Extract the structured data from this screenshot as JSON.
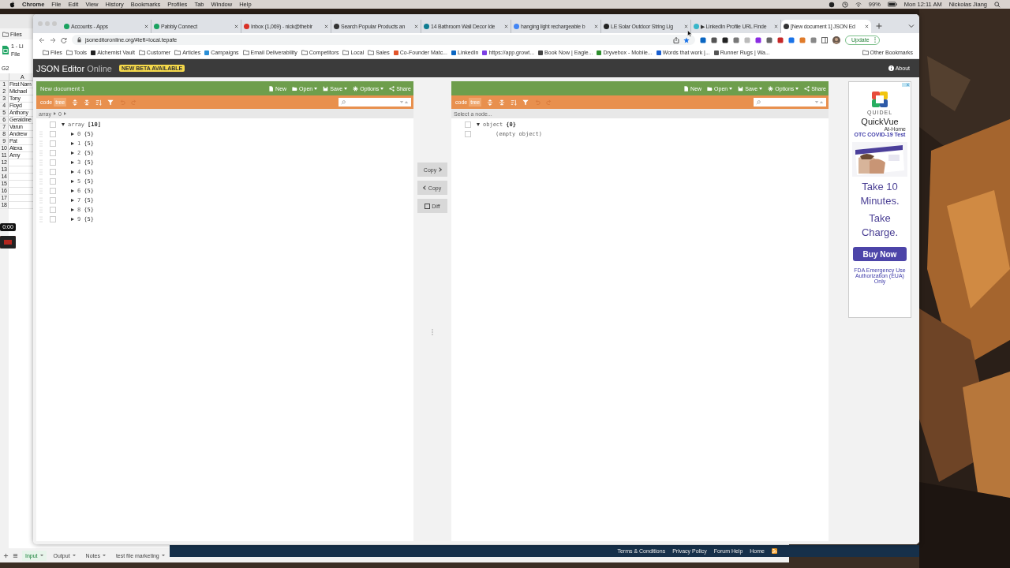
{
  "menu_bar": {
    "app": "Chrome",
    "menus": [
      "File",
      "Edit",
      "View",
      "History",
      "Bookmarks",
      "Profiles",
      "Tab",
      "Window",
      "Help"
    ],
    "battery": "99%",
    "clock": "Mon 12:11 AM",
    "user": "Nickolas Jiang"
  },
  "spreadsheet": {
    "bookmark": "Files",
    "title": "1 - Li",
    "menu": "File",
    "cell_ref": "G2",
    "column": "A",
    "timer": "0:00",
    "rows": [
      {
        "number": "1",
        "value": "First Nam"
      },
      {
        "number": "2",
        "value": "Michael"
      },
      {
        "number": "3",
        "value": "Tony"
      },
      {
        "number": "4",
        "value": "Floyd"
      },
      {
        "number": "5",
        "value": "Anthony"
      },
      {
        "number": "6",
        "value": "Geraldine"
      },
      {
        "number": "7",
        "value": "Varun"
      },
      {
        "number": "8",
        "value": "Andrew"
      },
      {
        "number": "9",
        "value": "Pat"
      },
      {
        "number": "10",
        "value": "Alexa"
      },
      {
        "number": "11",
        "value": "Amy"
      },
      {
        "number": "12"
      },
      {
        "number": "13"
      },
      {
        "number": "14"
      },
      {
        "number": "15"
      },
      {
        "number": "16"
      },
      {
        "number": "17"
      },
      {
        "number": "18"
      }
    ],
    "sheet_tabs": [
      {
        "label": "Input",
        "selected": true
      },
      {
        "label": "Output",
        "selected": false
      },
      {
        "label": "Notes",
        "selected": false
      },
      {
        "label": "test file marketing",
        "selected": false
      }
    ]
  },
  "browser": {
    "tabs": [
      {
        "title": "Accounts - Apps",
        "color": "#1aa260",
        "selected": false
      },
      {
        "title": "Pabbly Connect",
        "color": "#1aa260",
        "selected": false
      },
      {
        "title": "Inbox (1,069) - nick@thebir",
        "color": "#d93025",
        "selected": false
      },
      {
        "title": "Search Popular Products an",
        "color": "#333333",
        "selected": false
      },
      {
        "title": "14 Bathroom Wall Decor Ide",
        "color": "#0f7c91",
        "selected": false
      },
      {
        "title": "hanging light rechargeable b",
        "color": "#4285f4",
        "selected": false
      },
      {
        "title": "LE Solar Outdoor String Lig",
        "color": "#222222",
        "selected": false
      },
      {
        "title": "▶ LinkedIn Profile URL Finde",
        "color": "#38b6c9",
        "selected": false
      },
      {
        "title": "[New document 1]  JSON Ed",
        "color": "#333333",
        "selected": true
      }
    ],
    "url": "jsoneditoronline.org/#left=local.tepafe",
    "update_button": "Update",
    "bookmarks": [
      {
        "label": "Files",
        "kind": "folder"
      },
      {
        "label": "Tools",
        "kind": "folder"
      },
      {
        "label": "Alchemist Vault",
        "kind": "site",
        "color": "#222222"
      },
      {
        "label": "Customer",
        "kind": "folder"
      },
      {
        "label": "Articles",
        "kind": "folder"
      },
      {
        "label": "Campaigns",
        "kind": "site",
        "color": "#2a8fd6"
      },
      {
        "label": "Email Deliverability",
        "kind": "folder"
      },
      {
        "label": "Competitors",
        "kind": "folder"
      },
      {
        "label": "Local",
        "kind": "folder"
      },
      {
        "label": "Sales",
        "kind": "folder"
      },
      {
        "label": "Co-Founder Matc...",
        "kind": "site",
        "color": "#e2542a"
      },
      {
        "label": "LinkedIn",
        "kind": "site",
        "color": "#0a66c2"
      },
      {
        "label": "https://app.growt...",
        "kind": "site",
        "color": "#7b3fe4"
      },
      {
        "label": "Book Now | Eagle...",
        "kind": "site",
        "color": "#444444"
      },
      {
        "label": "Dryvebox - Mobile...",
        "kind": "site",
        "color": "#2f8f2f"
      },
      {
        "label": "Words that work |...",
        "kind": "site",
        "color": "#1a5fd0"
      },
      {
        "label": "Runner Rugs | Wa...",
        "kind": "site",
        "color": "#555555"
      }
    ],
    "other_bookmarks": "Other Bookmarks"
  },
  "app": {
    "logo": "JSON Editor",
    "logo_suffix": "Online",
    "badge": "NEW BETA AVAILABLE",
    "about": "About",
    "left_panel": {
      "title": "New document 1",
      "menu": [
        {
          "label": "New",
          "kind": "new",
          "dropdown": false
        },
        {
          "label": "Open",
          "kind": "open",
          "dropdown": true
        },
        {
          "label": "Save",
          "kind": "save",
          "dropdown": true
        },
        {
          "label": "Options",
          "kind": "options",
          "dropdown": true
        },
        {
          "label": "Share",
          "kind": "share",
          "dropdown": false
        }
      ],
      "modes": [
        {
          "label": "code",
          "selected": false
        },
        {
          "label": "tree",
          "selected": true
        }
      ],
      "breadcrumb": [
        "array",
        "0"
      ],
      "tree": {
        "key": "array",
        "count": "[10]",
        "expanded": true,
        "checked": false,
        "children": [
          {
            "key": "0",
            "value": "{5}",
            "expanded": false,
            "checked": false
          },
          {
            "key": "1",
            "value": "{5}",
            "expanded": false,
            "checked": false
          },
          {
            "key": "2",
            "value": "{5}",
            "expanded": false,
            "checked": false
          },
          {
            "key": "3",
            "value": "{5}",
            "expanded": false,
            "checked": false
          },
          {
            "key": "4",
            "value": "{5}",
            "expanded": false,
            "checked": false
          },
          {
            "key": "5",
            "value": "{5}",
            "expanded": false,
            "checked": false
          },
          {
            "key": "6",
            "value": "{5}",
            "expanded": false,
            "checked": false
          },
          {
            "key": "7",
            "value": "{5}",
            "expanded": false,
            "checked": false
          },
          {
            "key": "8",
            "value": "{5}",
            "expanded": false,
            "checked": false
          },
          {
            "key": "9",
            "value": "{5}",
            "expanded": false,
            "checked": false
          }
        ]
      }
    },
    "compare_buttons": [
      {
        "label": "Copy",
        "kind": "copy-right"
      },
      {
        "label": "Copy",
        "kind": "copy-left"
      },
      {
        "label": "Diff",
        "kind": "diff"
      }
    ],
    "right_panel": {
      "menu": [
        {
          "label": "New",
          "kind": "new",
          "dropdown": false
        },
        {
          "label": "Open",
          "kind": "open",
          "dropdown": true
        },
        {
          "label": "Save",
          "kind": "save",
          "dropdown": true
        },
        {
          "label": "Options",
          "kind": "options",
          "dropdown": true
        },
        {
          "label": "Share",
          "kind": "share",
          "dropdown": false
        }
      ],
      "modes": [
        {
          "label": "code",
          "selected": false
        },
        {
          "label": "tree",
          "selected": true
        }
      ],
      "status": "Select a node...",
      "tree": {
        "key": "object",
        "count": "{0}",
        "expanded": true,
        "checked": false,
        "empty_text": "(empty object)",
        "empty_checked": false
      }
    }
  },
  "ad": {
    "brand": "QUIDEL",
    "product": "QuickVue",
    "product_sub": "At-Home",
    "tagline": "OTC COVID-19 Test",
    "headline_1": "Take 10 Minutes.",
    "headline_2": "Take Charge.",
    "button": "Buy Now",
    "disclaimer": "FDA Emergency Use Authorization (EUA) Only"
  },
  "footer_links": [
    "Terms & Conditions",
    "Privacy Policy",
    "Forum Help",
    "Home"
  ]
}
